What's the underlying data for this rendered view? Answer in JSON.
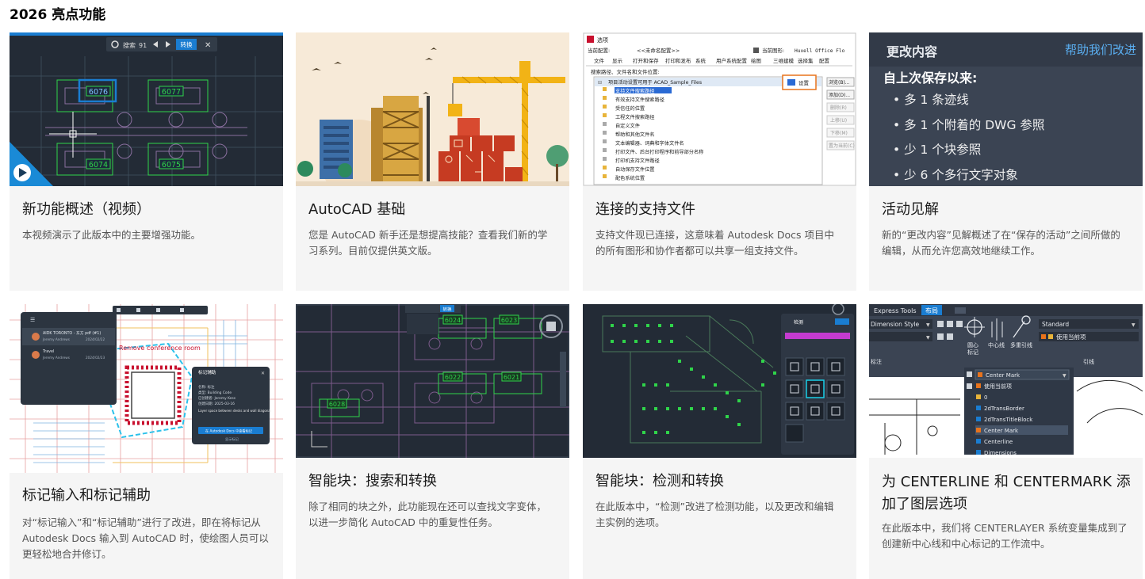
{
  "page": {
    "title": "2026 亮点功能"
  },
  "cards": [
    {
      "title": "新功能概述（视频）",
      "desc": "本视频演示了此版本中的主要增强功能。",
      "thumb": {
        "toolbar_search": "搜索",
        "toolbar_count": "91",
        "toolbar_convert": "转换",
        "labels": [
          "6076",
          "6077",
          "6074",
          "6075"
        ],
        "play_icon": "play-icon"
      }
    },
    {
      "title": "AutoCAD 基础",
      "desc": "您是 AutoCAD 新手还是想提高技能？查看我们新的学习系列。目前仅提供英文版。"
    },
    {
      "title": "连接的支持文件",
      "desc": "支持文件现已连接，这意味着 Autodesk Docs 项目中的所有图形和协作者都可以共享一组支持文件。",
      "thumb": {
        "window_title": "选项",
        "current_profile_label": "当前配置:",
        "current_profile": "<<未命名配置>>",
        "current_drawing_label": "当前图形:",
        "current_drawing": "Huxell Office Flo",
        "tabs": [
          "文件",
          "显示",
          "打开和保存",
          "打印和发布",
          "系统",
          "用户系统配置",
          "绘图",
          "三维建模",
          "选择集",
          "配置"
        ],
        "tree_label": "搜索路径、文件名和文件位置:",
        "tree_items": [
          "项目活动设置可用于 ACAD_Sample_Files",
          "支持文件搜索路径",
          "有效支持文件搜索路径",
          "受信任的位置",
          "工程文件搜索路径",
          "自定义文件",
          "帮助和其他文件名",
          "文本编辑器、词典和字体文件名",
          "打印文件、后台打印程序和前导部分名称",
          "打印机支持文件路径",
          "自动保存文件位置",
          "配色系统位置"
        ],
        "settings_button": "设置",
        "buttons": [
          "浏览(B)...",
          "添加(D)...",
          "删除(R)",
          "上移(U)",
          "下移(M)",
          "置为当前(C)"
        ]
      }
    },
    {
      "title": "活动见解",
      "desc": "新的“更改内容”见解概述了在“保存的活动”之间所做的编辑，从而允许您高效地继续工作。",
      "thumb": {
        "header": "更改内容",
        "help_link": "帮助我们改进",
        "subheader": "自上次保存以来:",
        "bullets": [
          "多 1 条迹线",
          "多 1 个附着的 DWG 参照",
          "少 1 个块参照",
          "少 6 个多行文字对象"
        ]
      }
    },
    {
      "title": "标记输入和标记辅助",
      "desc": "对“标记输入”和“标记辅助”进行了改进，即在将标记从 Autodesk Docs 输入到 AutoCAD 时，使绘图人员可以更轻松地合并修订。",
      "thumb": {
        "list_items": [
          {
            "name": "AIDK TORONTO - 东方 pdf (#1)",
            "user": "Jeremy Andrews",
            "date": "2024/02/22"
          },
          {
            "name": "Travel",
            "user": "Jeremy Andrews",
            "date": "2024/02/23"
          }
        ],
        "markup_text": "Remove conference room",
        "panel_title": "标记辅助",
        "panel_rows": [
          "名称: 标注",
          "类型: Building Code",
          "已创建者: Jeremy Kess",
          "创建日期: 2025-03-16"
        ],
        "panel_note": "Layer space between desks and wall diagonal",
        "panel_button": "在 Autodesk Docs 中查看标记",
        "panel_link": "显示标记"
      }
    },
    {
      "title": "智能块：搜索和转换",
      "desc": "除了相同的块之外，此功能现在还可以查找文字变体，以进一步简化 AutoCAD 中的重复性任务。",
      "thumb": {
        "labels": [
          "6024",
          "6023",
          "6022",
          "6021",
          "6028"
        ],
        "toolbar_convert": "转换"
      }
    },
    {
      "title": "智能块：检测和转换",
      "desc": "在此版本中，“检测”改进了检测功能，以及更改和编辑主实例的选项。",
      "thumb": {
        "panel_title": "检测"
      }
    },
    {
      "title": "为 CENTERLINE 和 CENTERMARK 添加了图层选项",
      "desc": "在此版本中，我们将 CENTERLAYER 系统变量集成到了创建新中心线和中心标记的工作流中。",
      "thumb": {
        "tabs": [
          "Express Tools",
          "布局"
        ],
        "dim_style": "Dimension Style",
        "standard": "Standard",
        "use_current": "使用当前项",
        "center_label": "圆心\n标记",
        "centerline_label": "中心线",
        "multileader_label": "多重引线",
        "annotation_label": "标注",
        "leader_label": "引线",
        "combo_value": "Center Mark",
        "layer_options": [
          "使用当前项",
          "0",
          "2dTransBorder",
          "2dTransTitleBlock",
          "Center Mark",
          "Centerline",
          "Dimensions"
        ]
      }
    }
  ]
}
